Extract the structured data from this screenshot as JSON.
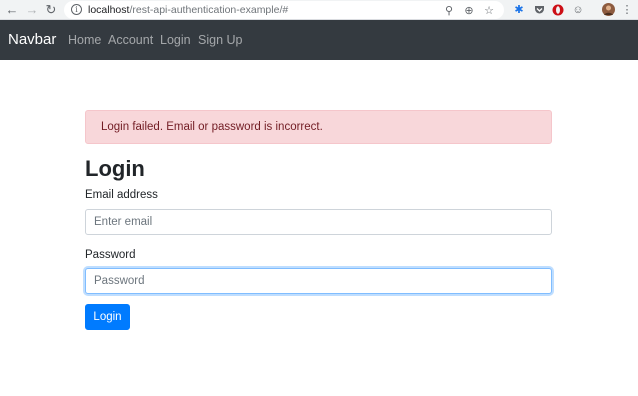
{
  "browser": {
    "url_host": "localhost",
    "url_path": "/rest-api-authentication-example/#",
    "icons": [
      "back-arrow-icon",
      "forward-arrow-icon",
      "reload-icon",
      "info-icon",
      "key-icon",
      "zoom-icon",
      "star-icon",
      "puzzle-icon",
      "pocket-icon",
      "opera-icon",
      "emoji-icon",
      "avatar"
    ]
  },
  "navbar": {
    "brand": "Navbar",
    "links": [
      "Home",
      "Account",
      "Login",
      "Sign Up"
    ]
  },
  "alert": {
    "message": "Login failed. Email or password is incorrect."
  },
  "form": {
    "title": "Login",
    "email_label": "Email address",
    "email_placeholder": "Enter email",
    "password_label": "Password",
    "password_placeholder": "Password",
    "submit_label": "Login"
  },
  "colors": {
    "navbar_bg": "#343a40",
    "alert_bg": "#f8d7da",
    "alert_text": "#721c24",
    "primary": "#007bff"
  }
}
